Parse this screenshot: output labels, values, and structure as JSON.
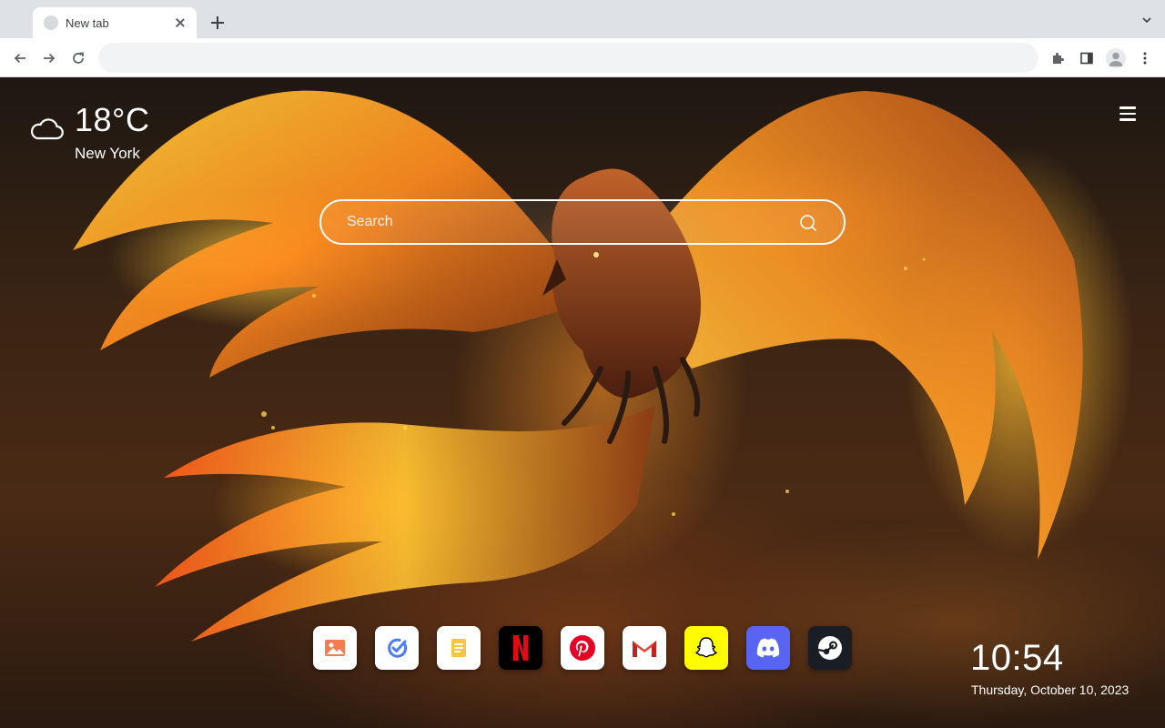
{
  "browser": {
    "tab_title": "New tab",
    "address_value": "",
    "colors": {
      "tabstrip": "#dee1e6",
      "toolbar": "#ffffff",
      "omnibox": "#f1f3f4"
    }
  },
  "weather": {
    "icon": "cloud-icon",
    "temperature": "18°C",
    "city": "New York"
  },
  "search": {
    "placeholder": "Search",
    "icon": "search-icon"
  },
  "apps": [
    {
      "id": "photos",
      "icon": "image-icon"
    },
    {
      "id": "tasks",
      "icon": "check-circle-icon"
    },
    {
      "id": "notes",
      "icon": "notes-icon"
    },
    {
      "id": "netflix",
      "icon": "netflix-icon"
    },
    {
      "id": "pinterest",
      "icon": "pinterest-icon"
    },
    {
      "id": "gmail",
      "icon": "gmail-icon"
    },
    {
      "id": "snapchat",
      "icon": "snapchat-icon"
    },
    {
      "id": "discord",
      "icon": "discord-icon"
    },
    {
      "id": "steam",
      "icon": "steam-icon"
    }
  ],
  "clock": {
    "time": "10:54",
    "date": "Thursday, October 10, 2023"
  },
  "theme": {
    "accent_fire": "#ffb020",
    "sky_dark": "#1e1712",
    "text": "#ffffff"
  }
}
